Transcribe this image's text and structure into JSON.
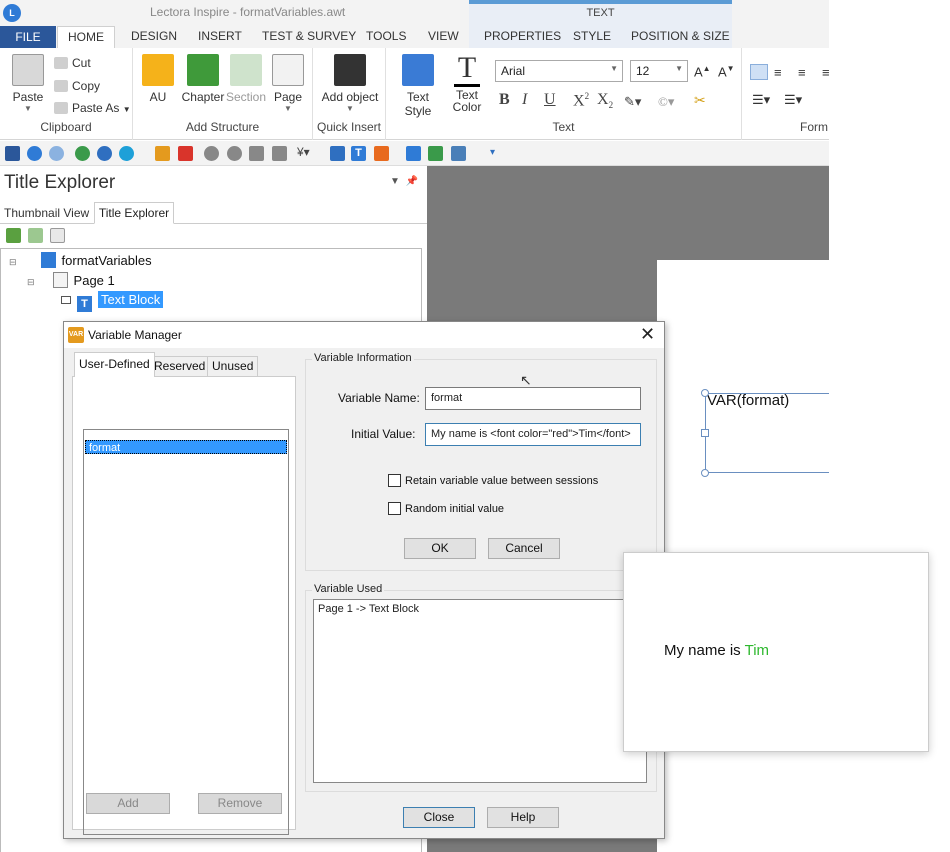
{
  "app": {
    "logo": "L",
    "title": "Lectora Inspire - formatVariables.awt"
  },
  "context_tab_group": "TEXT",
  "tabs": [
    "FILE",
    "HOME",
    "DESIGN",
    "INSERT",
    "TEST & SURVEY",
    "TOOLS",
    "VIEW",
    "PROPERTIES",
    "STYLE",
    "POSITION & SIZE"
  ],
  "ribbon": {
    "clipboard": {
      "paste": "Paste",
      "cut": "Cut",
      "copy": "Copy",
      "paste_as": "Paste As",
      "label": "Clipboard"
    },
    "structure": {
      "au": "AU",
      "chapter": "Chapter",
      "section": "Section",
      "page": "Page",
      "label": "Add Structure"
    },
    "quick_insert": {
      "add_object": "Add object",
      "label": "Quick Insert"
    },
    "text": {
      "text_style": "Text Style",
      "text_color": "Text Color",
      "font": "Arial",
      "size": "12",
      "label": "Text"
    },
    "format_label": "Form"
  },
  "panel": {
    "title": "Title Explorer",
    "tabs": [
      "Thumbnail View",
      "Title Explorer"
    ],
    "tree": {
      "root": "formatVariables",
      "page": "Page 1",
      "item": "Text Block"
    }
  },
  "canvas": {
    "text": "VAR(format)"
  },
  "dialog": {
    "title": "Variable Manager",
    "tabs": [
      "User-Defined",
      "Reserved",
      "Unused"
    ],
    "list_items": [
      "format"
    ],
    "add": "Add",
    "remove": "Remove",
    "info_group": "Variable Information",
    "name_label": "Variable Name:",
    "name_value": "format",
    "initial_label": "Initial Value:",
    "initial_value": "My name is <font color=\"red\">Tim</font>",
    "retain_label": "Retain variable value between sessions",
    "random_label": "Random initial value",
    "ok": "OK",
    "cancel": "Cancel",
    "used_group": "Variable Used",
    "used_items": [
      "Page 1 -> Text Block"
    ],
    "close": "Close",
    "help": "Help"
  },
  "preview": {
    "prefix": "My name is",
    "name": "Tim",
    "name_color": "#2eb82e"
  },
  "colors": {
    "accent": "#2b579a",
    "selection": "#3399ff",
    "canvas_gray": "#7a7a7a"
  }
}
